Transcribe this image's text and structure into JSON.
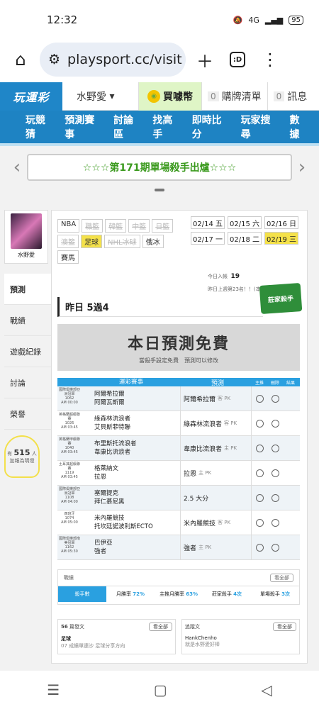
{
  "status": {
    "time": "12:32",
    "network": "4G",
    "battery": "95"
  },
  "browser": {
    "url": "playsport.cc/visit",
    "tabs": ":D"
  },
  "header": {
    "logo": "玩運彩",
    "user": "水野愛",
    "buy": "買噱幣",
    "cart_count": "0",
    "cart": "購牌清單",
    "msg_count": "0",
    "msg": "訊息"
  },
  "mainnav": [
    "玩競猜",
    "預測賽事",
    "討論區",
    "找高手",
    "即時比分",
    "玩家搜尋",
    "數據"
  ],
  "banner": "☆☆☆第171期單場殺手出爐☆☆☆",
  "sidebar": {
    "avatar_name": "水野愛",
    "items": [
      "預測",
      "戰績",
      "遊戲紀錄",
      "討論",
      "榮譽"
    ],
    "bulb_prefix": "有",
    "bulb_count": "515",
    "bulb_unit": "人",
    "bulb_text": "加報為明燈"
  },
  "leagues": [
    {
      "label": "NBA",
      "state": "normal"
    },
    {
      "label": "職籃",
      "state": "dis"
    },
    {
      "label": "韓籃",
      "state": "dis"
    },
    {
      "label": "中籃",
      "state": "dis"
    },
    {
      "label": "日籃",
      "state": "dis"
    },
    {
      "label": "澳籃",
      "state": "dis"
    },
    {
      "label": "足球",
      "state": "sel"
    },
    {
      "label": "NHL冰球",
      "state": "dis"
    },
    {
      "label": "俄冰",
      "state": "normal"
    },
    {
      "label": "賽馬",
      "state": "normal"
    }
  ],
  "dates": [
    {
      "label": "02/14 五",
      "sel": false
    },
    {
      "label": "02/15 六",
      "sel": false
    },
    {
      "label": "02/16 日",
      "sel": false
    },
    {
      "label": "02/17 一",
      "sel": false
    },
    {
      "label": "02/18 二",
      "sel": false
    },
    {
      "label": "02/19 三",
      "sel": true
    }
  ],
  "stats": {
    "today_label": "今日入帳",
    "today_value": "19",
    "note": "昨日上週第23名！！(本月7名)"
  },
  "yesterday": "昨日 5過4",
  "badge": "莊家殺手",
  "free": {
    "title": "本日預測免費",
    "sub": "當殺手設定免費　預測可以修改"
  },
  "table": {
    "headers": [
      "",
      "運彩賽事",
      "預測",
      "主推",
      "刪除",
      "結果"
    ],
    "rows": [
      {
        "league": "國際俱樂部亞洲冠軍",
        "no": "1062",
        "time": "AM 00:00",
        "home": "阿爾希拉爾",
        "away": "阿爾瓦斯爾",
        "pick": "阿爾希拉爾",
        "type": "客 PK"
      },
      {
        "league": "英格蘭超級聯賽",
        "no": "1026",
        "time": "AM 03:45",
        "home": "綠森林流浪者",
        "away": "艾貝斯菲特聯",
        "pick": "綠森林流浪者",
        "type": "客 PK"
      },
      {
        "league": "英格蘭甲級聯賽",
        "no": "1040",
        "time": "AM 03:45",
        "home": "布里斯托流浪者",
        "away": "韋康比流浪者",
        "pick": "韋康比流浪者",
        "type": "主 PK"
      },
      {
        "league": "土耳其超級聯賽",
        "no": "1119",
        "time": "AM 03:45",
        "home": "格萊納文",
        "away": "拉恩",
        "pick": "拉恩",
        "type": "主 PK"
      },
      {
        "league": "國際俱樂部亞洲冠軍",
        "no": "1108",
        "time": "AM 04:00",
        "home": "塞爾提克",
        "away": "拜仁慕尼黑",
        "pick": "2.5 大分",
        "type": ""
      },
      {
        "league": "西班牙",
        "no": "1074",
        "time": "AM 05:00",
        "home": "米內羅競技",
        "away": "托坎廷諾波利斯ECTO",
        "pick": "米內羅競技",
        "type": "客 PK"
      },
      {
        "league": "國際俱樂部南美冠軍",
        "no": "1162",
        "time": "AM 05:30",
        "home": "巴伊亞",
        "away": "強者",
        "pick": "強者",
        "type": "主 PK"
      }
    ]
  },
  "news": {
    "label": "戰績",
    "more": "看全部",
    "rates": [
      {
        "label": "殺手數",
        "value": ""
      },
      {
        "label": "月勝率",
        "value": "72%"
      },
      {
        "label": "主推月勝率",
        "value": "63%"
      },
      {
        "label": "莊家殺手",
        "value": "4次"
      },
      {
        "label": "單場殺手",
        "value": "3次"
      }
    ]
  },
  "bottom": {
    "left": {
      "count": "56",
      "label": "篇發文",
      "more": "看全部",
      "item": "足球",
      "sub": "07 成績單連沙 足球分享方向"
    },
    "right": {
      "label": "追蹤文",
      "more": "看全部",
      "name": "HankChenho",
      "sub": "就是水野愛好棒"
    }
  }
}
